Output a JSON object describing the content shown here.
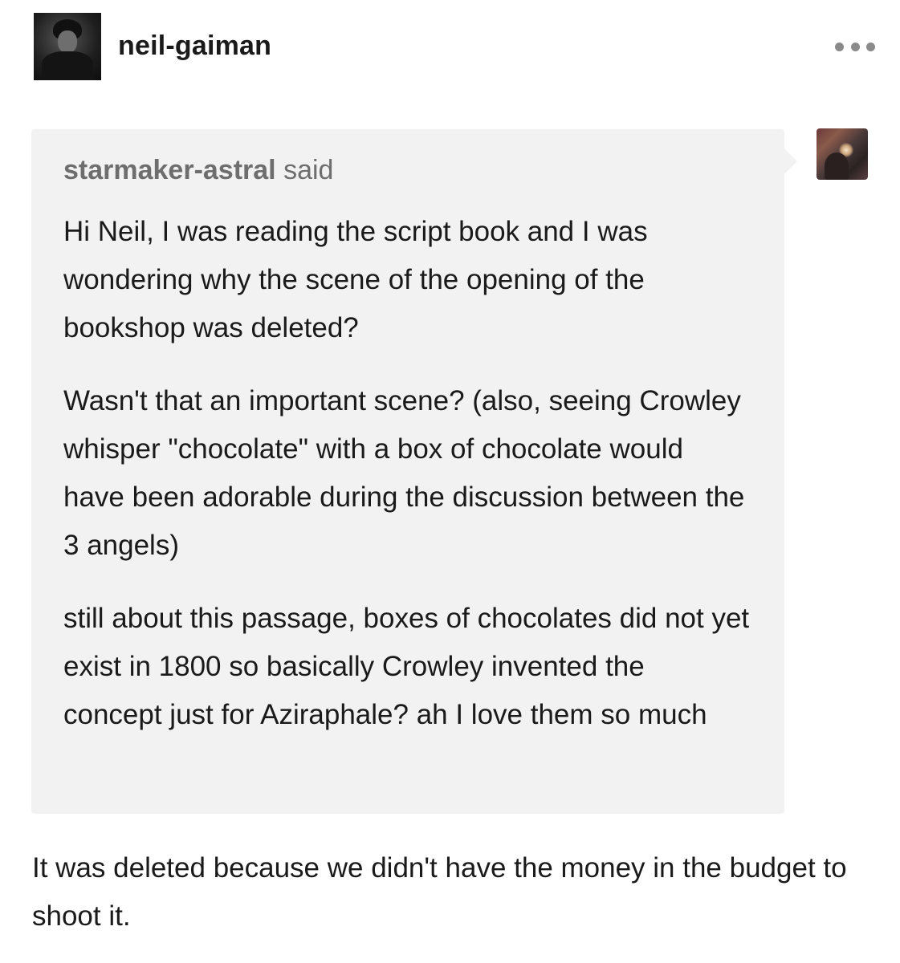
{
  "post": {
    "author": {
      "username": "neil-gaiman",
      "avatar_icon": "author-avatar-photo"
    },
    "menu_icon": "more-horizontal-icon",
    "ask": {
      "asker_name": "starmaker-astral",
      "said_word": "said",
      "asker_avatar_icon": "asker-avatar-art",
      "paragraphs": [
        "Hi Neil, I was reading the script book and I was wondering why the scene of the opening of the bookshop was deleted?",
        "Wasn't that an important scene? (also, seeing Crowley whisper \"chocolate\" with a box of chocolate would have been adorable during the discussion between the 3 angels)",
        "still about this passage, boxes of chocolates did not yet exist in 1800 so basically Crowley invented the concept just for Aziraphale? ah I love them so much"
      ]
    },
    "answer": "It was deleted because we didn't have the money in the budget to shoot it."
  }
}
